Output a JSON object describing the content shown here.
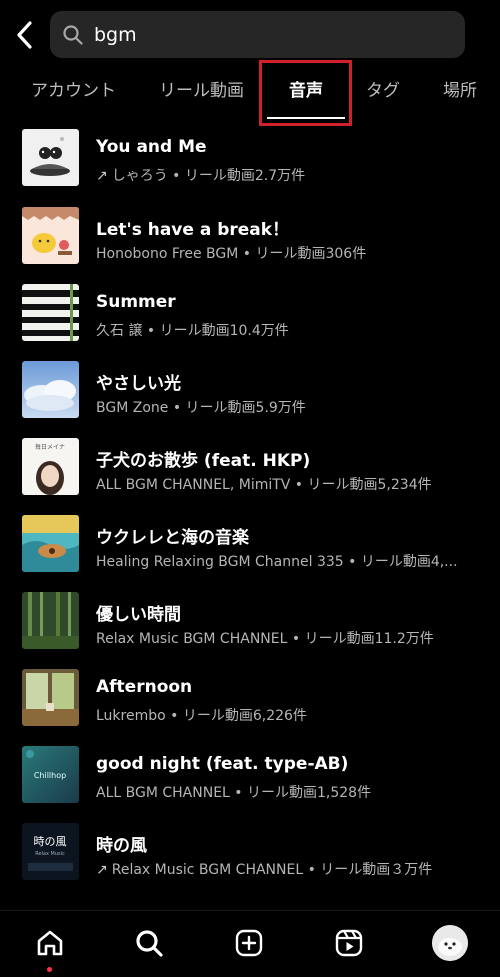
{
  "search": {
    "value": "bgm"
  },
  "tabs": [
    {
      "label": "アカウント"
    },
    {
      "label": "リール動画"
    },
    {
      "label": "音声"
    },
    {
      "label": "タグ"
    },
    {
      "label": "場所"
    }
  ],
  "active_tab": "音声",
  "items": [
    {
      "title": "You and Me",
      "subtitle": "しゃろう • リール動画2.7万件",
      "trending": true
    },
    {
      "title": "Let's have a break！",
      "subtitle": "Honobono Free BGM • リール動画306件",
      "trending": false
    },
    {
      "title": "Summer",
      "subtitle": "久石 譲 • リール動画10.4万件",
      "trending": false
    },
    {
      "title": "やさしい光",
      "subtitle": "BGM Zone • リール動画5.9万件",
      "trending": false
    },
    {
      "title": "子犬のお散歩 (feat. HKP)",
      "subtitle": "ALL BGM CHANNEL, MimiTV • リール動画5,234件",
      "trending": false
    },
    {
      "title": "ウクレレと海の音楽",
      "subtitle": "Healing Relaxing BGM Channel 335 • リール動画4,...",
      "trending": false
    },
    {
      "title": "優しい時間",
      "subtitle": "Relax Music BGM CHANNEL • リール動画11.2万件",
      "trending": false
    },
    {
      "title": "Afternoon",
      "subtitle": "Lukrembo • リール動画6,226件",
      "trending": false
    },
    {
      "title": "good night (feat. type-AB)",
      "subtitle": "ALL BGM CHANNEL • リール動画1,528件",
      "trending": false
    },
    {
      "title": "時の風",
      "subtitle": "Relax Music BGM CHANNEL • リール動画３万件",
      "trending": true
    }
  ],
  "thumb_text": {
    "t5": "毎日メイナ",
    "t9": "Chillhop",
    "t10_title": "時の風",
    "t10_sub": "Relax Music"
  },
  "trend_arrow": "↗",
  "icons": {
    "back": "chevron-left-icon",
    "search": "search-icon",
    "nav": [
      "home-icon",
      "search-icon",
      "create-icon",
      "reels-icon",
      "profile-avatar"
    ]
  },
  "colors": {
    "highlight": "#d0202a",
    "notification_dot": "#ff3040"
  }
}
